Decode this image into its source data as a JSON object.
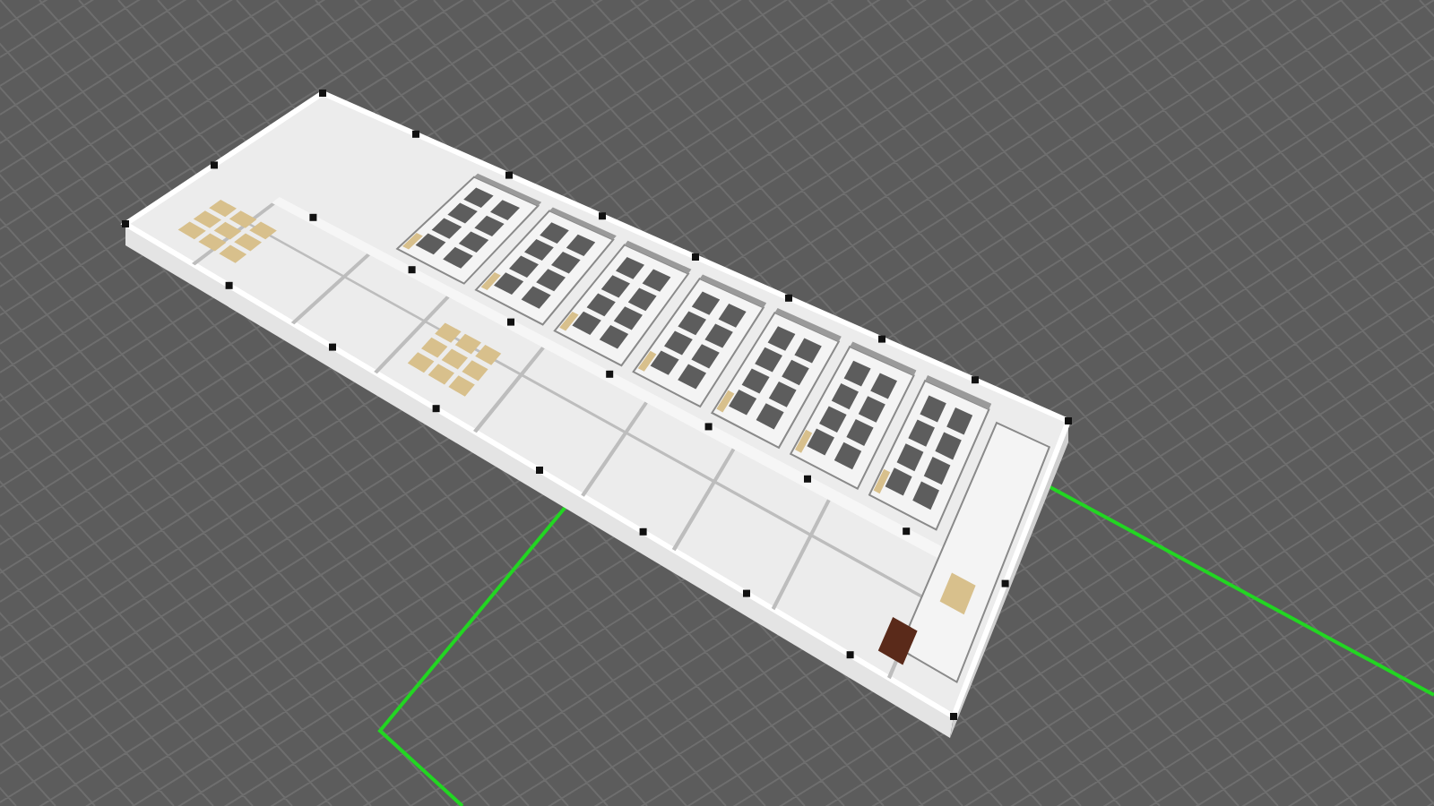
{
  "scene": {
    "kind": "floor-plan-3d",
    "grid": true,
    "boundary": true
  }
}
